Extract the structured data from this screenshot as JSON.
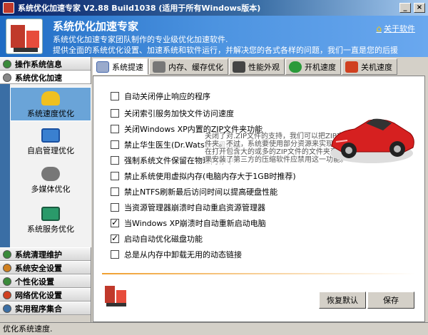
{
  "window": {
    "title": "系统优化加速专家 V2.88 Build1038 (适用于所有Windows版本)"
  },
  "banner": {
    "heading": "系统优化加速专家",
    "desc_line1": "系统优化加速专家团队制作的专业级优化加速软件.",
    "desc_line2": "提供全面的系统优化设置、加速系统和软件运行，并解决您的各式各样的问题，我们一直是您的后援",
    "about_link": "关于软件"
  },
  "sidebar": {
    "categories_top": [
      {
        "label": "操作系统信息",
        "icon": "info-icon",
        "color": "#3a8a3a"
      },
      {
        "label": "系统优化加速",
        "icon": "gear-icon",
        "color": "#555555"
      }
    ],
    "subitems": [
      {
        "label": "系统速度优化",
        "icon": "car-icon",
        "color": "#f0c020"
      },
      {
        "label": "自启管理优化",
        "icon": "window-icon",
        "color": "#3a80d0"
      },
      {
        "label": "多媒体优化",
        "icon": "media-icon",
        "color": "#666666"
      },
      {
        "label": "系统服务优化",
        "icon": "service-icon",
        "color": "#2a9a6a"
      }
    ],
    "categories_bottom": [
      {
        "label": "系统清理维护",
        "icon": "clean-icon",
        "color": "#3a8a3a"
      },
      {
        "label": "系统安全设置",
        "icon": "security-icon",
        "color": "#d08020"
      },
      {
        "label": "个性化设置",
        "icon": "personalize-icon",
        "color": "#3a8a3a"
      },
      {
        "label": "网络优化设置",
        "icon": "network-icon",
        "color": "#d04020"
      },
      {
        "label": "实用程序集合",
        "icon": "tools-icon",
        "color": "#3a6ea5"
      }
    ]
  },
  "tabs": [
    {
      "label": "系统提速",
      "icon": "speed-icon",
      "active": true
    },
    {
      "label": "内存、缓存优化",
      "icon": "memory-icon",
      "active": false
    },
    {
      "label": "性能外观",
      "icon": "appearance-icon",
      "active": false
    },
    {
      "label": "开机速度",
      "icon": "boot-icon",
      "active": false
    },
    {
      "label": "关机速度",
      "icon": "shutdown-icon",
      "active": false
    }
  ],
  "options": [
    {
      "label": "自动关闭停止响应的程序",
      "checked": false
    },
    {
      "label": "关闭索引服务加快文件访问速度",
      "checked": false
    },
    {
      "label": "关闭Windows XP内置的ZIP文件夹功能",
      "checked": false
    },
    {
      "label": "禁止华生医生(Dr.Watson)调试器",
      "checked": false
    },
    {
      "label": "强制系统文件保留在物理内存中",
      "checked": false
    },
    {
      "label": "禁止系统使用虚拟内存(电脑内存大于1GB时推荐)",
      "checked": false
    },
    {
      "label": "禁止NTFS刷新最后访问时间以提高硬盘性能",
      "checked": false
    },
    {
      "label": "当资源管理器崩溃时自动重启资源管理器",
      "checked": false
    },
    {
      "label": "当Windows XP崩溃时自动重新启动电脑",
      "checked": true
    },
    {
      "label": "启动自动优化磁盘功能",
      "checked": true
    },
    {
      "label": "总是从内存中卸载无用的动态链接",
      "checked": false
    }
  ],
  "tooltip": "关闭了对.ZIP文件的支持，我们可以把ZIP文件当作文件夹。不过，系统要使用部分资源来实现这一功能，在打开包含大的或多的ZIP文件的文件夹变得很慢，如果安装了第三方的压缩软件应禁用这一功能。",
  "buttons": {
    "restore": "恢复默认",
    "save": "保存"
  },
  "status": {
    "text": "优化系统速度."
  },
  "colors": {
    "banner": "#1f6cc4",
    "selected": "#6aa4d8",
    "accent": "#f0a030"
  }
}
